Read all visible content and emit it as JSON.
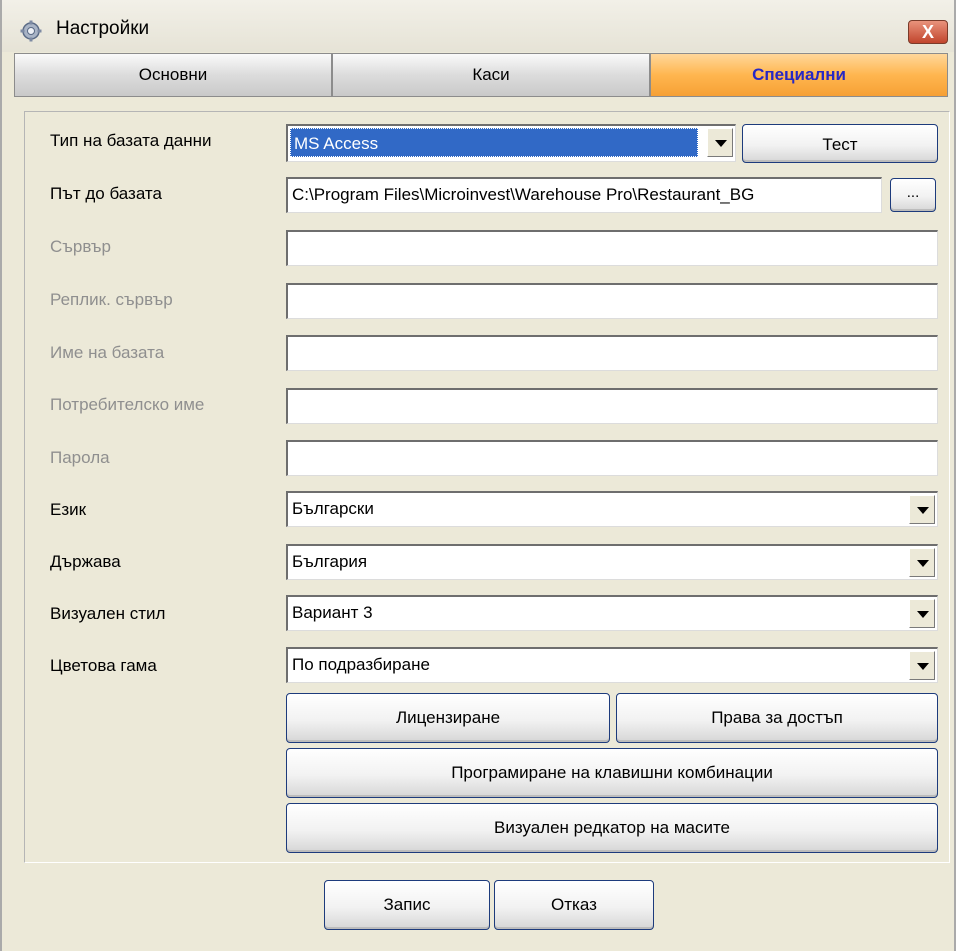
{
  "window": {
    "title": "Настройки",
    "close_label": "X"
  },
  "tabs": [
    {
      "label": "Основни",
      "active": false
    },
    {
      "label": "Каси",
      "active": false
    },
    {
      "label": "Специални",
      "active": true
    }
  ],
  "colors": {
    "active_tab": "#ffb64f",
    "active_tab_text": "#2727c4",
    "selection": "#3169c6",
    "close_button": "#c1452d"
  },
  "form": {
    "db_type": {
      "label": "Тип на базата данни",
      "value": "MS Access",
      "test_button": "Тест"
    },
    "db_path": {
      "label": "Път до базата",
      "value": "C:\\Program Files\\Microinvest\\Warehouse Pro\\Restaurant_BG",
      "browse_button": "..."
    },
    "server": {
      "label": "Сървър",
      "value": ""
    },
    "replica_server": {
      "label": "Реплик. сървър",
      "value": ""
    },
    "db_name": {
      "label": "Име на базата",
      "value": ""
    },
    "username": {
      "label": "Потребителско име",
      "value": ""
    },
    "password": {
      "label": "Парола",
      "value": ""
    },
    "language": {
      "label": "Език",
      "value": "Български"
    },
    "country": {
      "label": "Държава",
      "value": "България"
    },
    "visual_style": {
      "label": "Визуален стил",
      "value": "Вариант 3"
    },
    "color_scheme": {
      "label": "Цветова гама",
      "value": "По подразбиране"
    }
  },
  "buttons": {
    "licensing": "Лицензиране",
    "access_rights": "Права за достъп",
    "hotkeys": "Програмиране на клавишни комбинации",
    "table_editor": "Визуален редкатор на масите",
    "save": "Запис",
    "cancel": "Отказ"
  }
}
